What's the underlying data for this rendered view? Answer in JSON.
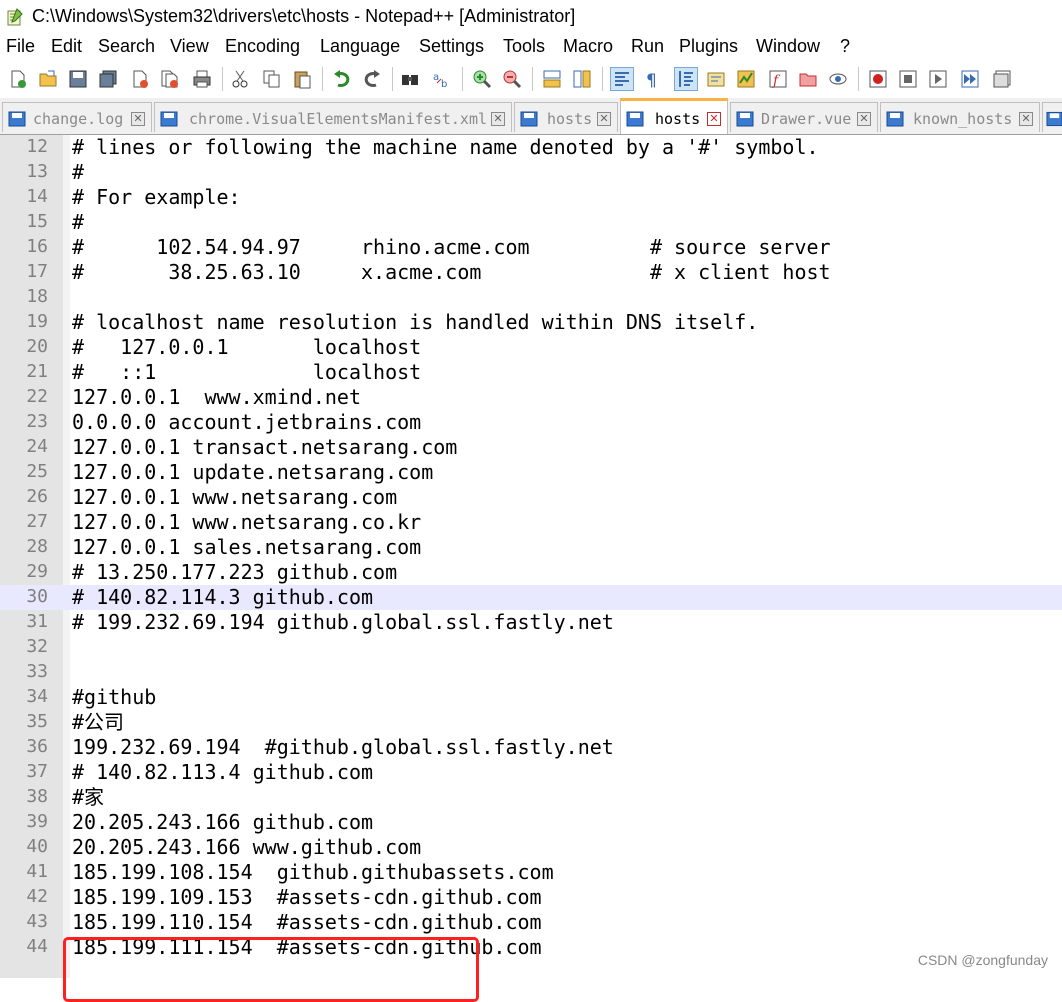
{
  "window": {
    "title": "C:\\Windows\\System32\\drivers\\etc\\hosts - Notepad++ [Administrator]",
    "app_icon": "notepad-plus-plus-icon"
  },
  "menu": [
    "File",
    "Edit",
    "Search",
    "View",
    "Encoding",
    "Language",
    "Settings",
    "Tools",
    "Macro",
    "Run",
    "Plugins",
    "Window",
    "?"
  ],
  "toolbar": {
    "icons": [
      "new-file-icon",
      "open-file-icon",
      "save-icon",
      "save-all-icon",
      "close-icon",
      "close-all-icon",
      "print-icon",
      "cut-icon",
      "copy-icon",
      "paste-icon",
      "undo-icon",
      "redo-icon",
      "find-icon",
      "replace-icon",
      "zoom-in-icon",
      "zoom-out-icon",
      "sync-vertical-icon",
      "sync-horizontal-icon",
      "word-wrap-icon",
      "show-all-chars-icon",
      "indent-guide-icon",
      "user-language-icon",
      "document-map-icon",
      "function-list-icon",
      "folder-workspace-icon",
      "monitoring-icon",
      "record-macro-icon",
      "stop-macro-icon",
      "play-macro-icon",
      "run-macro-multiple-icon",
      "save-macro-icon"
    ]
  },
  "tabs": [
    {
      "label": "change.log",
      "active": false
    },
    {
      "label": "chrome.VisualElementsManifest.xml",
      "active": false
    },
    {
      "label": "hosts",
      "active": false
    },
    {
      "label": "hosts",
      "active": true
    },
    {
      "label": "Drawer.vue",
      "active": false
    },
    {
      "label": "known_hosts",
      "active": false
    }
  ],
  "editor": {
    "highlighted_line": 30,
    "lines": [
      {
        "n": "12",
        "text": "# lines or following the machine name denoted by a '#' symbol."
      },
      {
        "n": "13",
        "text": "#"
      },
      {
        "n": "14",
        "text": "# For example:"
      },
      {
        "n": "15",
        "text": "#"
      },
      {
        "n": "16",
        "text": "#      102.54.94.97     rhino.acme.com          # source server"
      },
      {
        "n": "17",
        "text": "#       38.25.63.10     x.acme.com              # x client host"
      },
      {
        "n": "18",
        "text": ""
      },
      {
        "n": "19",
        "text": "# localhost name resolution is handled within DNS itself."
      },
      {
        "n": "20",
        "text": "#   127.0.0.1       localhost"
      },
      {
        "n": "21",
        "text": "#   ::1             localhost"
      },
      {
        "n": "22",
        "text": "127.0.0.1  www.xmind.net"
      },
      {
        "n": "23",
        "text": "0.0.0.0 account.jetbrains.com"
      },
      {
        "n": "24",
        "text": "127.0.0.1 transact.netsarang.com"
      },
      {
        "n": "25",
        "text": "127.0.0.1 update.netsarang.com"
      },
      {
        "n": "26",
        "text": "127.0.0.1 www.netsarang.com"
      },
      {
        "n": "27",
        "text": "127.0.0.1 www.netsarang.co.kr"
      },
      {
        "n": "28",
        "text": "127.0.0.1 sales.netsarang.com"
      },
      {
        "n": "29",
        "text": "# 13.250.177.223 github.com"
      },
      {
        "n": "30",
        "text": "# 140.82.114.3 github.com"
      },
      {
        "n": "31",
        "text": "# 199.232.69.194 github.global.ssl.fastly.net"
      },
      {
        "n": "32",
        "text": ""
      },
      {
        "n": "33",
        "text": ""
      },
      {
        "n": "34",
        "text": "#github"
      },
      {
        "n": "35",
        "text": "#公司"
      },
      {
        "n": "36",
        "text": "199.232.69.194  #github.global.ssl.fastly.net"
      },
      {
        "n": "37",
        "text": "# 140.82.113.4 github.com"
      },
      {
        "n": "38",
        "text": "#家"
      },
      {
        "n": "39",
        "text": "20.205.243.166 github.com"
      },
      {
        "n": "40",
        "text": "20.205.243.166 www.github.com"
      },
      {
        "n": "41",
        "text": "185.199.108.154  github.githubassets.com"
      },
      {
        "n": "42",
        "text": "185.199.109.153  #assets-cdn.github.com"
      },
      {
        "n": "43",
        "text": "185.199.110.154  #assets-cdn.github.com"
      },
      {
        "n": "44",
        "text": "185.199.111.154  #assets-cdn.github.com"
      }
    ]
  },
  "colors": {
    "current_line": "#e8e8ff",
    "annotation": "#ff2020",
    "active_tab_accent": "#fbb144"
  },
  "watermark": "CSDN @zongfunday"
}
